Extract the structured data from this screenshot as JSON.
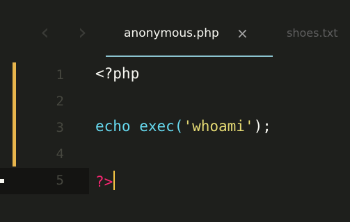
{
  "tabs": {
    "active": {
      "label": "anonymous.php",
      "close": "×"
    },
    "inactive": {
      "label": "shoes.txt"
    }
  },
  "nav": {
    "back": "‹",
    "forward": "›"
  },
  "editor": {
    "lines": [
      {
        "number": "1",
        "text_a": "<?php",
        "text_b": "",
        "text_c": "",
        "text_d": ""
      },
      {
        "number": "2",
        "text_a": "",
        "text_b": "",
        "text_c": "",
        "text_d": ""
      },
      {
        "number": "3",
        "text_a": "echo",
        "text_b": " exec(",
        "text_c": "'whoami'",
        "text_d": ");"
      },
      {
        "number": "4",
        "text_a": "",
        "text_b": "",
        "text_c": "",
        "text_d": ""
      },
      {
        "number": "5",
        "text_a": "?>",
        "text_b": "",
        "text_c": "",
        "text_d": ""
      }
    ]
  },
  "colors": {
    "background": "#1e1f1c",
    "gutter_modified": "#e8b54c",
    "tab_underline": "#8bc3cf",
    "cursor": "#f8c744"
  }
}
